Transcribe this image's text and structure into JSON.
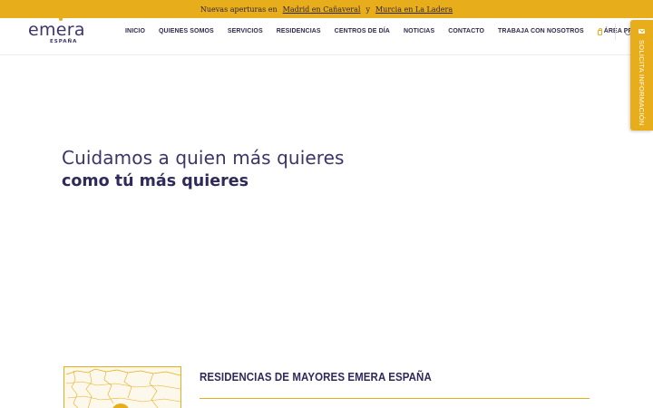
{
  "announcement": {
    "prefix": "Nuevas aperturas en",
    "link1": "Madrid en Cañaveral",
    "conj": "y",
    "link2": "Murcia en La Ladera"
  },
  "logo": {
    "word": "emera",
    "sub": "ESPAÑA"
  },
  "nav": {
    "items": [
      {
        "label": "INICIO"
      },
      {
        "label": "QUIENES SOMOS"
      },
      {
        "label": "SERVICIOS"
      },
      {
        "label": "RESIDENCIAS"
      },
      {
        "label": "CENTROS DE DÍA"
      },
      {
        "label": "NOTICIAS"
      },
      {
        "label": "CONTACTO"
      },
      {
        "label": "TRABAJA CON NOSOTROS"
      }
    ],
    "area_privada": "ÁREA PRIVADA"
  },
  "side_tab": {
    "label": "SOLICITA INFORMACIÓN",
    "icon": "envelope-icon"
  },
  "hero": {
    "line1": "Cuidamos a quien más quieres",
    "line2": "como tú más quieres"
  },
  "section": {
    "title": "RESIDENCIAS DE MAYORES EMERA ESPAÑA"
  },
  "colors": {
    "accent": "#e8ad1a",
    "brand": "#3d356b"
  }
}
